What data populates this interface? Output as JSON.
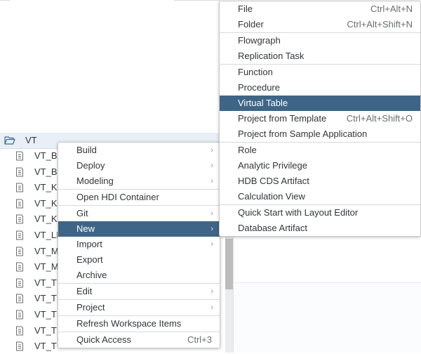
{
  "tree": {
    "folder": {
      "label": "VT",
      "icon": "folder-open-icon",
      "selected": true
    },
    "items": [
      {
        "label": "VT_B"
      },
      {
        "label": "VT_B"
      },
      {
        "label": "VT_K"
      },
      {
        "label": "VT_K"
      },
      {
        "label": "VT_K"
      },
      {
        "label": "VT_LI"
      },
      {
        "label": "VT_M"
      },
      {
        "label": "VT_M"
      },
      {
        "label": "VT_T"
      },
      {
        "label": "VT_T"
      },
      {
        "label": "VT_T"
      },
      {
        "label": "VT_T"
      },
      {
        "label": "VT_T"
      }
    ]
  },
  "context_menu": {
    "items": [
      {
        "label": "Build",
        "submenu": true
      },
      {
        "label": "Deploy",
        "submenu": true
      },
      {
        "label": "Modeling",
        "submenu": true
      },
      {
        "label": "Open HDI Container",
        "separator_before": true
      },
      {
        "label": "Git",
        "submenu": true,
        "separator_before": true
      },
      {
        "label": "New",
        "submenu": true,
        "active": true
      },
      {
        "label": "Import",
        "submenu": true
      },
      {
        "label": "Export"
      },
      {
        "label": "Archive"
      },
      {
        "label": "Edit",
        "submenu": true,
        "separator_before": true
      },
      {
        "label": "Project",
        "submenu": true,
        "separator_before": true
      },
      {
        "label": "Refresh Workspace Items",
        "separator_before": true
      },
      {
        "label": "Quick Access",
        "shortcut": "Ctrl+3",
        "separator_before": true
      }
    ]
  },
  "new_submenu": {
    "items": [
      {
        "label": "File",
        "shortcut": "Ctrl+Alt+N"
      },
      {
        "label": "Folder",
        "shortcut": "Ctrl+Alt+Shift+N"
      },
      {
        "label": "Flowgraph",
        "separator_before": true
      },
      {
        "label": "Replication Task"
      },
      {
        "label": "Function",
        "separator_before": true
      },
      {
        "label": "Procedure"
      },
      {
        "label": "Virtual Table",
        "active": true
      },
      {
        "label": "Project from Template",
        "shortcut": "Ctrl+Alt+Shift+O"
      },
      {
        "label": "Project from Sample Application"
      },
      {
        "label": "Role",
        "separator_before": true
      },
      {
        "label": "Analytic Privilege"
      },
      {
        "label": "HDB CDS Artifact"
      },
      {
        "label": "Calculation View"
      },
      {
        "label": "Quick Start with Layout Editor",
        "separator_before": true
      },
      {
        "label": "Database Artifact"
      }
    ]
  },
  "colors": {
    "accent_selected": "#3f6586",
    "tree_selected_bg": "#e8eff6",
    "text": "#32363a"
  }
}
